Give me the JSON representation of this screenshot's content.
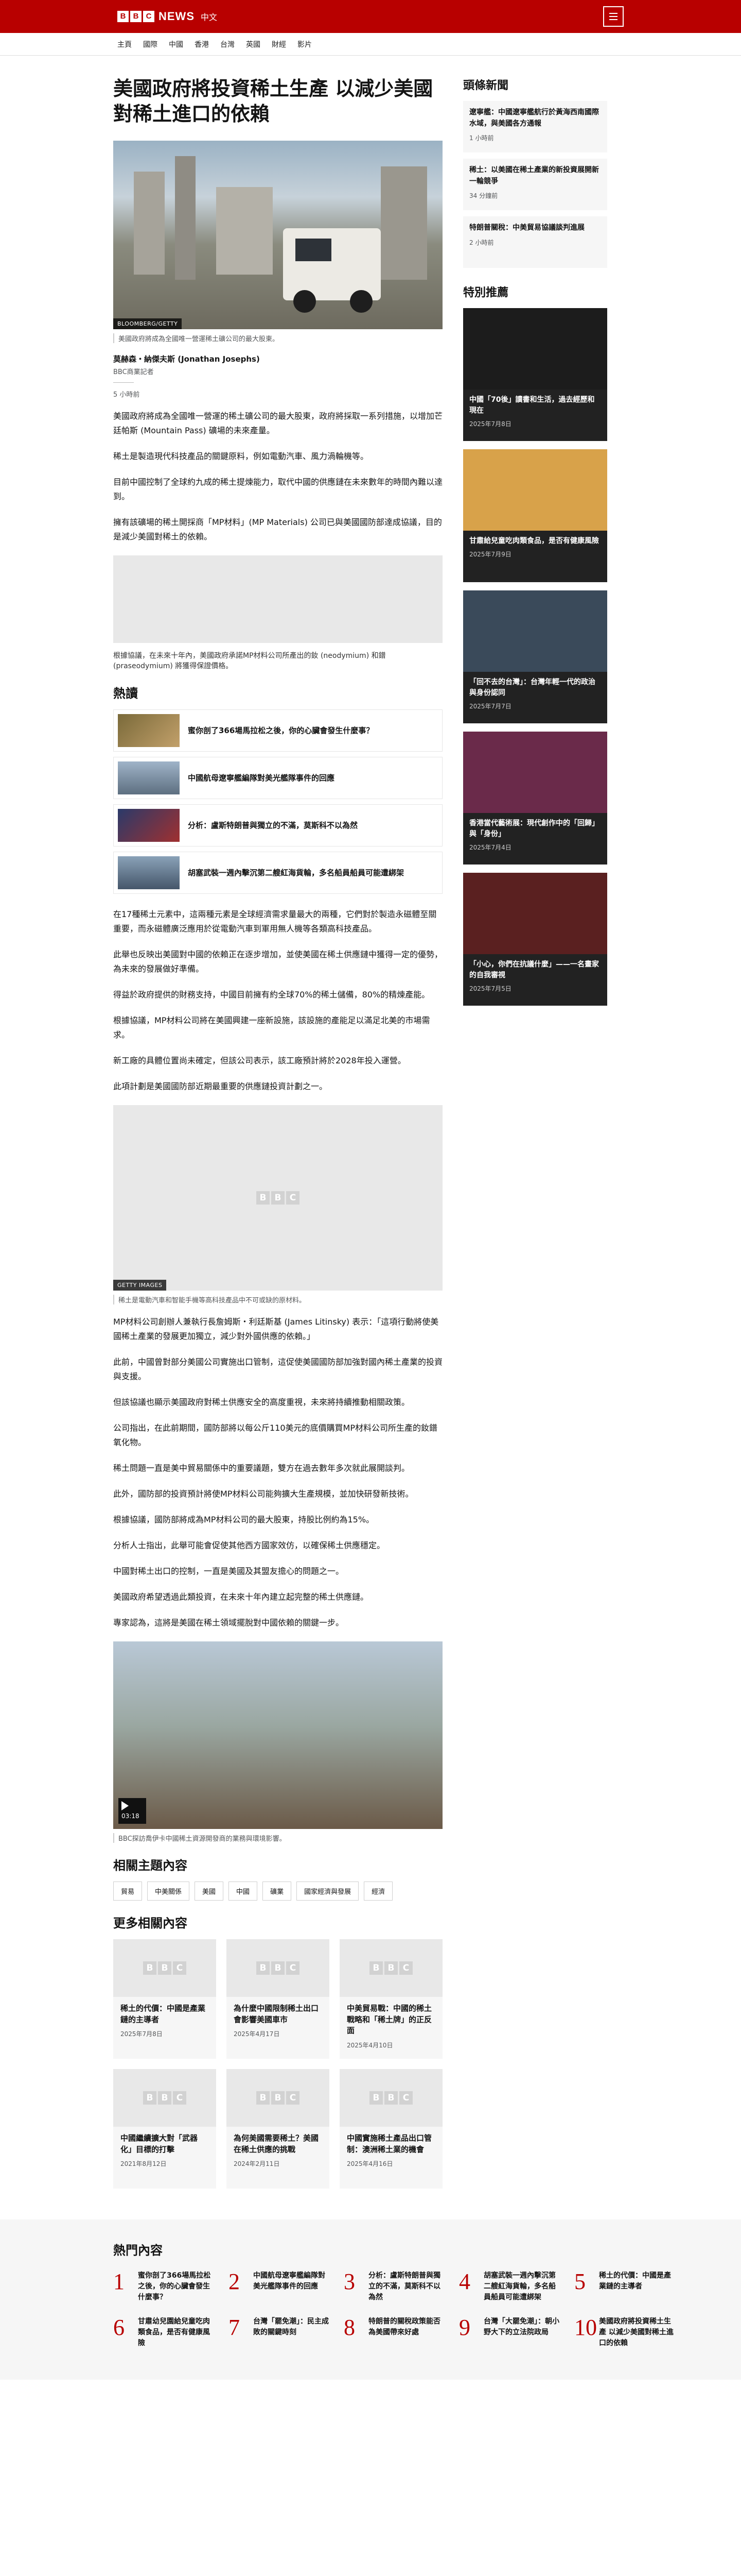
{
  "header": {
    "brand": [
      "B",
      "B",
      "C"
    ],
    "brand_name": "NEWS",
    "lang": "中文"
  },
  "nav": [
    "主頁",
    "國際",
    "中國",
    "香港",
    "台灣",
    "英國",
    "財經",
    "影片"
  ],
  "article": {
    "title": "美國政府將投資稀土生產 以減少美國對稀土進口的依賴",
    "image_credit": "BLOOMBERG/GETTY",
    "image_caption": "美國政府將成為全國唯一營運稀土礦公司的最大股東。",
    "author": "莫赫森・納傑夫斯 (Jonathan Josephs)",
    "author_role": "BBC商業記者",
    "date": "5 小時前",
    "paragraphs_a": [
      "美國政府將成為全國唯一營運的稀土礦公司的最大股東，政府將採取一系列措施，以增加芒廷帕斯 (Mountain Pass) 礦場的未來產量。",
      "稀土是製造現代科技產品的關鍵原料，例如電動汽車、風力渦輪機等。",
      "目前中國控制了全球約九成的稀土提煉能力，取代中國的供應鏈在未來數年的時間內難以達到。",
      "擁有該礦場的稀土開採商「MP材料」(MP Materials) 公司已與美國國防部達成協議，目的是減少美國對稀土的依賴。"
    ],
    "caption2": "根據協議，在未來十年內，美國政府承諾MP材料公司所產出的釹 (neodymium) 和鐠 (praseodymium) 將獲得保證價格。",
    "hot_title": "熱讀",
    "hot_items": [
      "蜜你剖了366場馬拉松之後，你的心臟會發生什麼事？",
      "中國航母遼寧艦編隊對美光艦隊事件的回應",
      "分析：盧斯特朗普與獨立的不滿，莫斯科不以為然",
      "胡塞武裝一週內擊沉第二艘紅海貨輪，多名船員船員可能遭綁架"
    ],
    "paragraphs_b": [
      "在17種稀土元素中，這兩種元素是全球經濟需求量最大的兩種，它們對於製造永磁體至關重要，而永磁體廣泛應用於從電動汽車到軍用無人機等各類高科技產品。",
      "此舉也反映出美國對中國的依賴正在逐步增加，並使美國在稀土供應鏈中獲得一定的優勢，為未來的發展做好準備。",
      "得益於政府提供的財務支持，中國目前擁有約全球70%的稀土儲備，80%的精煉產能。",
      "根據協議，MP材料公司將在美國興建一座新設施，該設施的產能足以滿足北美的市場需求。",
      "新工廠的具體位置尚未確定，但該公司表示，該工廠預計將於2028年投入運營。",
      "此項計劃是美國國防部近期最重要的供應鏈投資計劃之一。"
    ],
    "figure2_credit": "GETTY IMAGES",
    "figure2_caption": "稀土是電動汽車和智能手機等高科技產品中不可或缺的原材料。",
    "paragraphs_c": [
      "MP材料公司創辦人兼執行長詹姆斯・利廷斯基 (James Litinsky) 表示：「這項行動將使美國稀土產業的發展更加獨立，減少對外國供應的依賴。」",
      "此前，中國曾對部分美國公司實施出口管制，這促使美國國防部加強對國內稀土產業的投資與支援。",
      "但該協議也顯示美國政府對稀土供應安全的高度重視，未來將持續推動相關政策。",
      "公司指出，在此前期間，國防部將以每公斤110美元的底價購買MP材料公司所生產的釹鐠氧化物。",
      "稀土問題一直是美中貿易關係中的重要議題，雙方在過去數年多次就此展開談判。",
      "此外，國防部的投資預計將使MP材料公司能夠擴大生產規模，並加快研發新技術。",
      "根據協議，國防部將成為MP材料公司的最大股東，持股比例約為15%。",
      "分析人士指出，此舉可能會促使其他西方國家效仿，以確保稀土供應穩定。",
      "中國對稀土出口的控制，一直是美國及其盟友擔心的問題之一。",
      "美國政府希望透過此類投資，在未來十年內建立起完整的稀土供應鏈。",
      "專家認為，這將是美國在稀土領域擺脫對中國依賴的關鍵一步。"
    ],
    "video_time": "03:18",
    "video_caption": "BBC探訪喬伊卡中國稀土資源開發商的業務與環境影響。",
    "topics_title": "相關主題內容",
    "topics": [
      "貿易",
      "中美關係",
      "美國",
      "中國",
      "礦業",
      "國家經濟與發展",
      "經濟"
    ],
    "more_title": "更多相關內容",
    "more": [
      {
        "title": "稀土的代價：中國是產業鏈的主導者",
        "date": "2025年7月8日"
      },
      {
        "title": "為什麼中國限制稀土出口會影響美國車市",
        "date": "2025年4月17日"
      },
      {
        "title": "中美貿易戰：中國的稀土戰略和「稀土牌」的正反面",
        "date": "2025年4月10日"
      },
      {
        "title": "中國繼續擴大對「武器化」目標的打擊",
        "date": "2021年8月12日"
      },
      {
        "title": "為何美國需要稀土？美國在稀土供應的挑戰",
        "date": "2024年2月11日"
      },
      {
        "title": "中國實施稀土產品出口管制：澳洲稀土業的機會",
        "date": "2025年4月16日"
      }
    ]
  },
  "sidebar": {
    "top_title": "頭條新聞",
    "top": [
      {
        "title": "遼寧艦：中國遼寧艦航行於黃海西南國際水域，與美國各方通報",
        "date": "1 小時前"
      },
      {
        "title": "稀土：以美國在稀土產業的新投資展開新一輪競爭",
        "date": "34 分鐘前"
      },
      {
        "title": "特朗普關稅：中美貿易協議談判進展",
        "date": "2 小時前"
      }
    ],
    "feat_title": "特別推薦",
    "feat": [
      {
        "title": "中國「70後」讀書和生活，過去經歷和現在",
        "date": "2025年7月8日",
        "bg": "#1c1c1c"
      },
      {
        "title": "甘肅給兒童吃肉類食品，是否有健康風險",
        "date": "2025年7月9日",
        "bg": "#d8a24a"
      },
      {
        "title": "「回不去的台灣」：台灣年輕一代的政治與身份認同",
        "date": "2025年7月7日",
        "bg": "#3a4a5a"
      },
      {
        "title": "香港當代藝術展：現代創作中的「回歸」與「身份」",
        "date": "2025年7月4日",
        "bg": "#6a2a4a"
      },
      {
        "title": "「小心，你們在抗議什麼」——一名畫家的自我審視",
        "date": "2025年7月5日",
        "bg": "#5a2020"
      }
    ]
  },
  "popular": {
    "title": "熱門內容",
    "items": [
      "蜜你剖了366場馬拉松之後，你的心臟會發生什麼事？",
      "中國航母遼寧艦編隊對美光艦隊事件的回應",
      "分析：盧斯特朗普與獨立的不滿，莫斯科不以為然",
      "胡塞武裝一週內擊沉第二艘紅海貨輪，多名船員船員可能遭綁架",
      "稀土的代價：中國是產業鏈的主導者",
      "甘肅幼兒園給兒童吃肉類食品，是否有健康風險",
      "台灣「罷免潮」：民主成敗的關鍵時刻",
      "特朗普的關稅政策能否為美國帶來好處",
      "台灣「大罷免潮」：朝小野大下的立法院政局",
      "美國政府將投資稀土生產 以減少美國對稀土進口的依賴"
    ]
  },
  "placeholder_logo": [
    "B",
    "B",
    "C"
  ]
}
